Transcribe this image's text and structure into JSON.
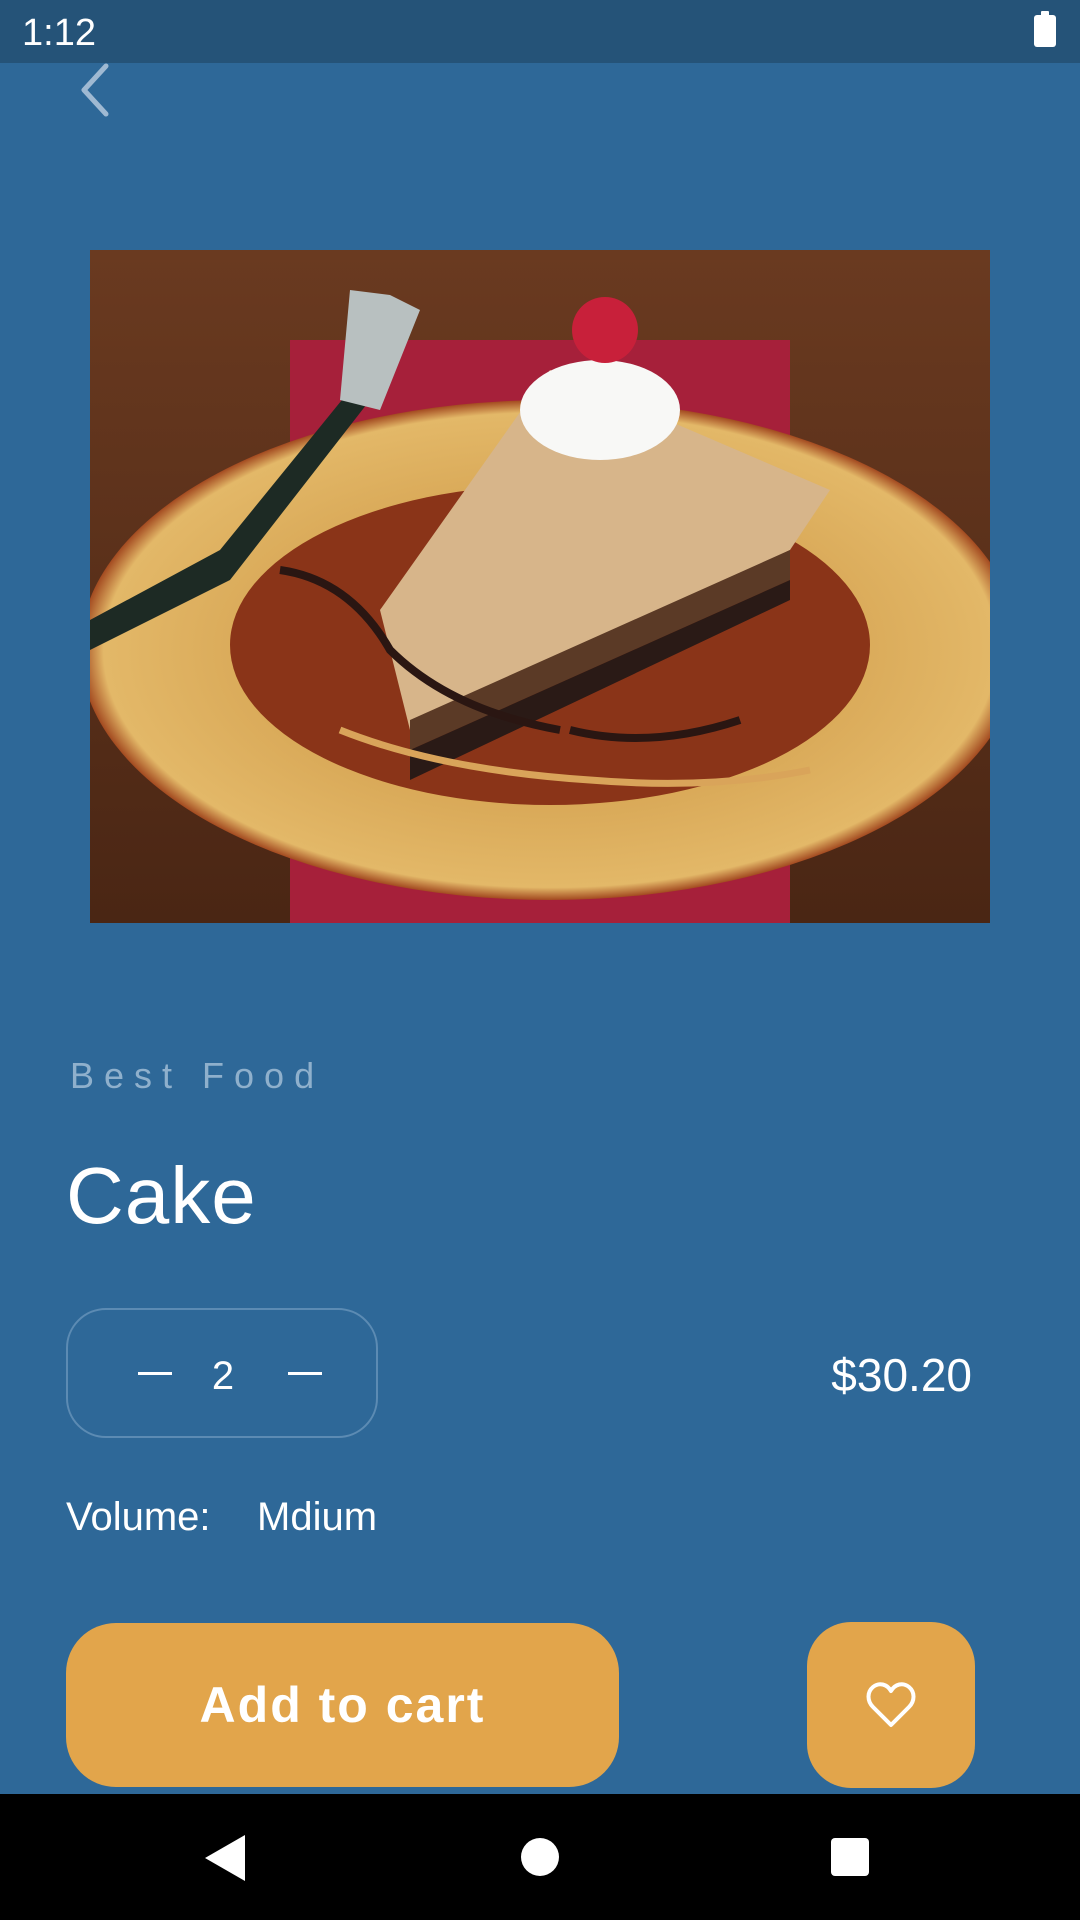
{
  "status_bar": {
    "time": "1:12",
    "battery_icon": "battery-full-icon"
  },
  "header": {
    "back_icon": "chevron-left-icon"
  },
  "product": {
    "image_alt": "cake-slice-image",
    "category": "Best Food",
    "name": "Cake",
    "quantity": "2",
    "price": "$30.20",
    "volume_label": "Volume:",
    "volume_value": "Mdium"
  },
  "actions": {
    "add_to_cart_label": "Add to cart",
    "favorite_icon": "heart-outline-icon"
  },
  "nav_bar": {
    "back_icon": "triangle-back-icon",
    "home_icon": "circle-home-icon",
    "recents_icon": "square-recents-icon"
  },
  "colors": {
    "background": "#2e6898",
    "status_bar": "#255378",
    "accent": "#e2a54b",
    "muted_text": "#8fb0cc"
  }
}
